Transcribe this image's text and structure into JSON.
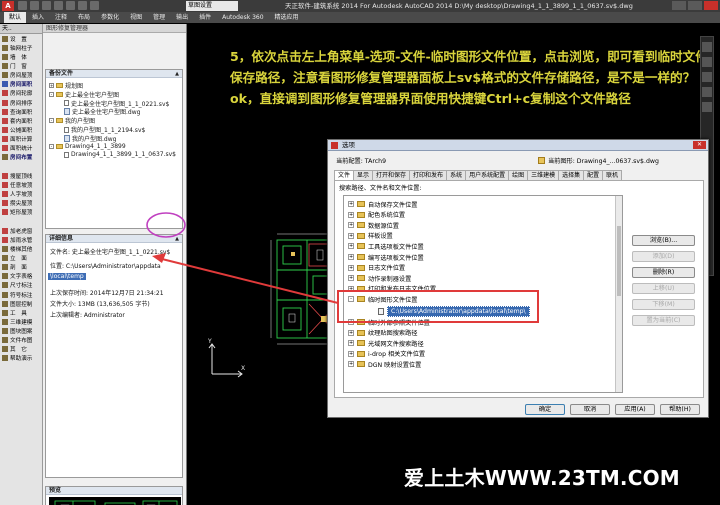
{
  "titlebar": {
    "app_icon": "A",
    "workspace": "草图设置",
    "title": "天正软件-建筑系统 2014  For Autodesk AutoCAD 2014   D:\\My desktop\\Drawing4_1_1_3899_1_1_0637.sv$.dwg"
  },
  "ribbon": {
    "tabs": [
      "默认",
      "插入",
      "注释",
      "布局",
      "参数化",
      "视图",
      "管理",
      "输出",
      "插件",
      "Autodesk 360",
      "精选应用"
    ]
  },
  "lefttool": {
    "header": "天..",
    "items": [
      {
        "label": "设　置",
        "color": "#7a6a3a",
        "group": false
      },
      {
        "label": "轴网柱子",
        "color": "#7a6a3a",
        "group": false
      },
      {
        "label": "墙　体",
        "color": "#7a6a3a",
        "group": false
      },
      {
        "label": "门　窗",
        "color": "#7a6a3a",
        "group": false
      },
      {
        "label": "房间屋顶",
        "color": "#7a6a3a",
        "group": false
      },
      {
        "label": "房间面积",
        "color": "#3a5ab0",
        "group": true
      },
      {
        "label": "房间轮廓",
        "color": "#c04040",
        "group": false
      },
      {
        "label": "房间排序",
        "color": "#c04040",
        "group": false
      },
      {
        "label": "查询面积",
        "color": "#c04040",
        "group": false
      },
      {
        "label": "套内面积",
        "color": "#c04040",
        "group": false
      },
      {
        "label": "公摊面积",
        "color": "#c04040",
        "group": false
      },
      {
        "label": "面积计算",
        "color": "#c04040",
        "group": false
      },
      {
        "label": "面积统计",
        "color": "#c04040",
        "group": false
      },
      {
        "label": "房间布置",
        "color": "#7a6a3a",
        "group": true
      },
      {
        "label": "",
        "color": "#e4e4e4",
        "group": false
      },
      {
        "label": "搜屋顶线",
        "color": "#c04040",
        "group": false
      },
      {
        "label": "任意坡顶",
        "color": "#c04040",
        "group": false
      },
      {
        "label": "人字坡顶",
        "color": "#c04040",
        "group": false
      },
      {
        "label": "攒尖屋顶",
        "color": "#c04040",
        "group": false
      },
      {
        "label": "矩形屋顶",
        "color": "#c04040",
        "group": false
      },
      {
        "label": "",
        "color": "#e4e4e4",
        "group": false
      },
      {
        "label": "加老虎窗",
        "color": "#c04040",
        "group": false
      },
      {
        "label": "加雨水管",
        "color": "#c04040",
        "group": false
      },
      {
        "label": "楼梯其他",
        "color": "#7a6a3a",
        "group": false
      },
      {
        "label": "立　面",
        "color": "#7a6a3a",
        "group": false
      },
      {
        "label": "剖　面",
        "color": "#7a6a3a",
        "group": false
      },
      {
        "label": "文字表格",
        "color": "#7a6a3a",
        "group": false
      },
      {
        "label": "尺寸标注",
        "color": "#7a6a3a",
        "group": false
      },
      {
        "label": "符号标注",
        "color": "#7a6a3a",
        "group": false
      },
      {
        "label": "图层控制",
        "color": "#7a6a3a",
        "group": false
      },
      {
        "label": "工　具",
        "color": "#7a6a3a",
        "group": false
      },
      {
        "label": "三维建模",
        "color": "#7a6a3a",
        "group": false
      },
      {
        "label": "图块图案",
        "color": "#7a6a3a",
        "group": false
      },
      {
        "label": "文件布图",
        "color": "#7a6a3a",
        "group": false
      },
      {
        "label": "其　它",
        "color": "#7a6a3a",
        "group": false
      },
      {
        "label": "帮助演示",
        "color": "#7a6a3a",
        "group": false
      }
    ]
  },
  "recovery": {
    "header": "图形修复管理器",
    "backup_title": "备份文件",
    "tree": [
      {
        "label": "规划图",
        "icon": "folder",
        "expander": "+",
        "level": 1
      },
      {
        "label": "史上最全住宅户型图",
        "icon": "folder",
        "expander": "-",
        "level": 1
      },
      {
        "label": "史上最全住宅户型图_1_1_0221.sv$",
        "icon": "file",
        "expander": "",
        "level": 2
      },
      {
        "label": "史上最全住宅户型图.dwg",
        "icon": "dwg",
        "expander": "",
        "level": 2
      },
      {
        "label": "我的户型图",
        "icon": "folder",
        "expander": "-",
        "level": 1
      },
      {
        "label": "我的户型图_1_1_2194.sv$",
        "icon": "file",
        "expander": "",
        "level": 2
      },
      {
        "label": "我的户型图.dwg",
        "icon": "dwg",
        "expander": "",
        "level": 2
      },
      {
        "label": "Drawing4_1_1_3899",
        "icon": "folder",
        "expander": "-",
        "level": 1
      },
      {
        "label": "Drawing4_1_1_3899_1_1_0637.sv$",
        "icon": "file",
        "expander": "",
        "level": 2
      }
    ],
    "details_title": "详细信息",
    "details": {
      "file_name": "文件名: 史上最全住宅户型图_1_1_0221.sv$",
      "location": "位置: C:\\Users\\Administrator\\appdata",
      "location_cont": "\\local\\temp",
      "last_saved": "上次保存时间: 2014年12月7日   21:34:21",
      "file_size": "文件大小: 13MB (13,636,505 字节)",
      "last_editor": "上次编辑者: Administrator"
    },
    "preview_title": "预览"
  },
  "annotation": "5，依次点击左上角菜单-选项-文件-临时图形文件位置，点击浏览，即可看到临时文件保存路径，注意看图形修复管理器面板上sv$格式的文件存储路径，是不是一样的？ok，直接调到图形修复管理器界面使用快捷键Ctrl+c复制这个文件路径",
  "dialog": {
    "title": "选项",
    "close_label": "✕",
    "current_profile": "当前配置:          TArch9",
    "current_drawing": "当前图形:          Drawing4_...0637.sv$.dwg",
    "tabs": [
      {
        "label": "文件",
        "active": true
      },
      {
        "label": "显示",
        "active": false
      },
      {
        "label": "打开和保存",
        "active": false
      },
      {
        "label": "打印和发布",
        "active": false
      },
      {
        "label": "系统",
        "active": false
      },
      {
        "label": "用户系统配置",
        "active": false
      },
      {
        "label": "绘图",
        "active": false
      },
      {
        "label": "三维建模",
        "active": false
      },
      {
        "label": "选择集",
        "active": false
      },
      {
        "label": "配置",
        "active": false
      },
      {
        "label": "联机",
        "active": false
      }
    ],
    "section_label": "搜索路径、文件名和文件位置:",
    "tree": [
      {
        "label": "自动保存文件位置",
        "expander": "+"
      },
      {
        "label": "配色系统位置",
        "expander": "+"
      },
      {
        "label": "数据源位置",
        "expander": "+"
      },
      {
        "label": "样板设置",
        "expander": "+"
      },
      {
        "label": "工具选项板文件位置",
        "expander": "+"
      },
      {
        "label": "编写选项板文件位置",
        "expander": "+"
      },
      {
        "label": "日志文件位置",
        "expander": "+"
      },
      {
        "label": "动作录制器设置",
        "expander": "+"
      },
      {
        "label": "打印和发布日志文件位置",
        "expander": "+"
      },
      {
        "label": "临时图形文件位置",
        "expander": "-"
      },
      {
        "label": "临时外部参照文件位置",
        "expander": "+"
      },
      {
        "label": "纹理贴图搜索路径",
        "expander": "+"
      },
      {
        "label": "光域网文件搜索路径",
        "expander": "+"
      },
      {
        "label": "i-drop 相关文件位置",
        "expander": "+"
      },
      {
        "label": "DGN 映射设置位置",
        "expander": "+"
      }
    ],
    "temp_path": "C:\\Users\\Administrator\\appdata\\local\\temp\\",
    "side_buttons": [
      {
        "label": "浏览(B)...",
        "disabled": false
      },
      {
        "label": "添加(D)",
        "disabled": true
      },
      {
        "label": "删除(R)",
        "disabled": false
      },
      {
        "label": "上移(U)",
        "disabled": true
      },
      {
        "label": "下移(M)",
        "disabled": true
      },
      {
        "label": "置为当前(C)",
        "disabled": true
      }
    ],
    "footer_buttons": [
      {
        "label": "确定",
        "default": true
      },
      {
        "label": "取消",
        "default": false
      },
      {
        "label": "应用(A)",
        "default": false
      },
      {
        "label": "帮助(H)",
        "default": false
      }
    ]
  },
  "watermark": "爱上土木WWW.23TM.COM",
  "colors": {
    "annotation": "#d9d43c",
    "callout": "#e03a3a",
    "highlight_ellipse": "#c040c0",
    "selection": "#3e6db5",
    "cad_green": "#2fd14d"
  }
}
